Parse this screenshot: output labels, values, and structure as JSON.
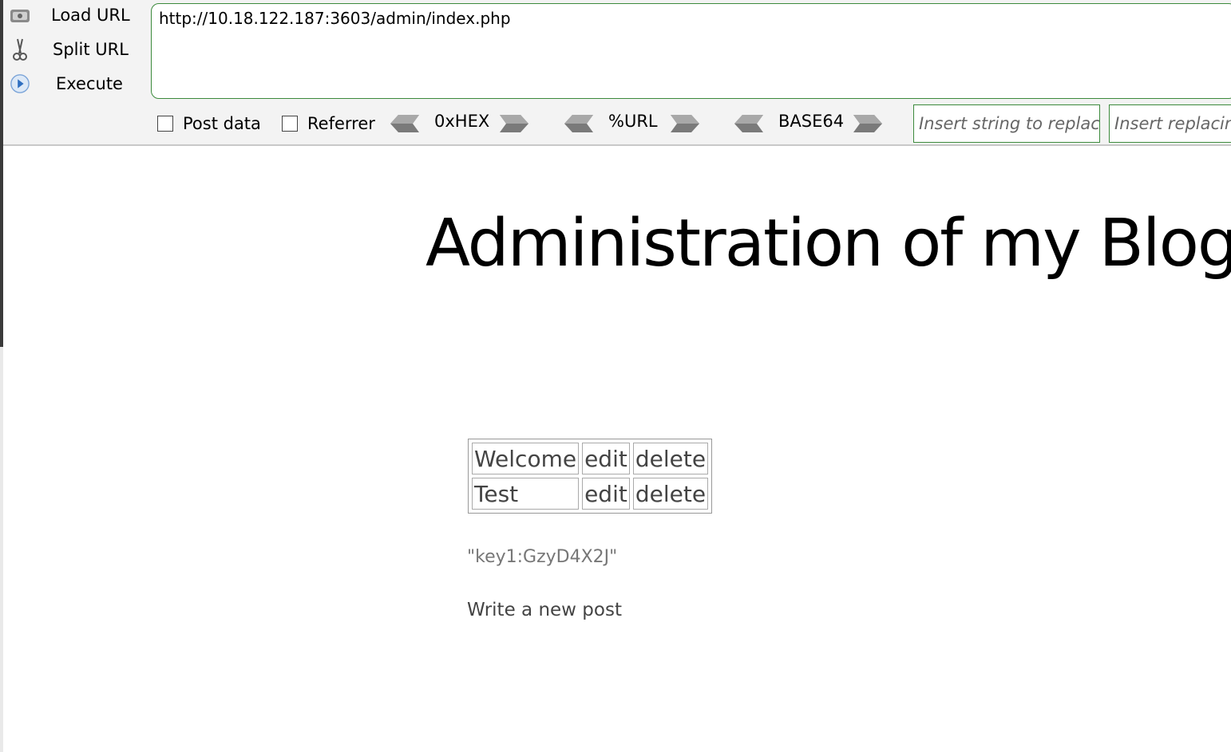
{
  "toolbar": {
    "load_url": "Load URL",
    "split_url": "Split URL",
    "execute": "Execute",
    "url": "http://10.18.122.187:3603/admin/index.php",
    "post_data": "Post data",
    "referrer": "Referrer",
    "hex": "0xHEX",
    "urlenc": "%URL",
    "base64": "BASE64",
    "replace_placeholder": "Insert string to replace",
    "replacing_placeholder": "Insert replacing string"
  },
  "page": {
    "title": "Administration of my Blog",
    "posts": [
      {
        "title": "Welcome",
        "edit": "edit",
        "delete": "delete"
      },
      {
        "title": "Test",
        "edit": "edit",
        "delete": "delete"
      }
    ],
    "key": "\"key1:GzyD4X2J\"",
    "new_post": "Write a new post"
  }
}
